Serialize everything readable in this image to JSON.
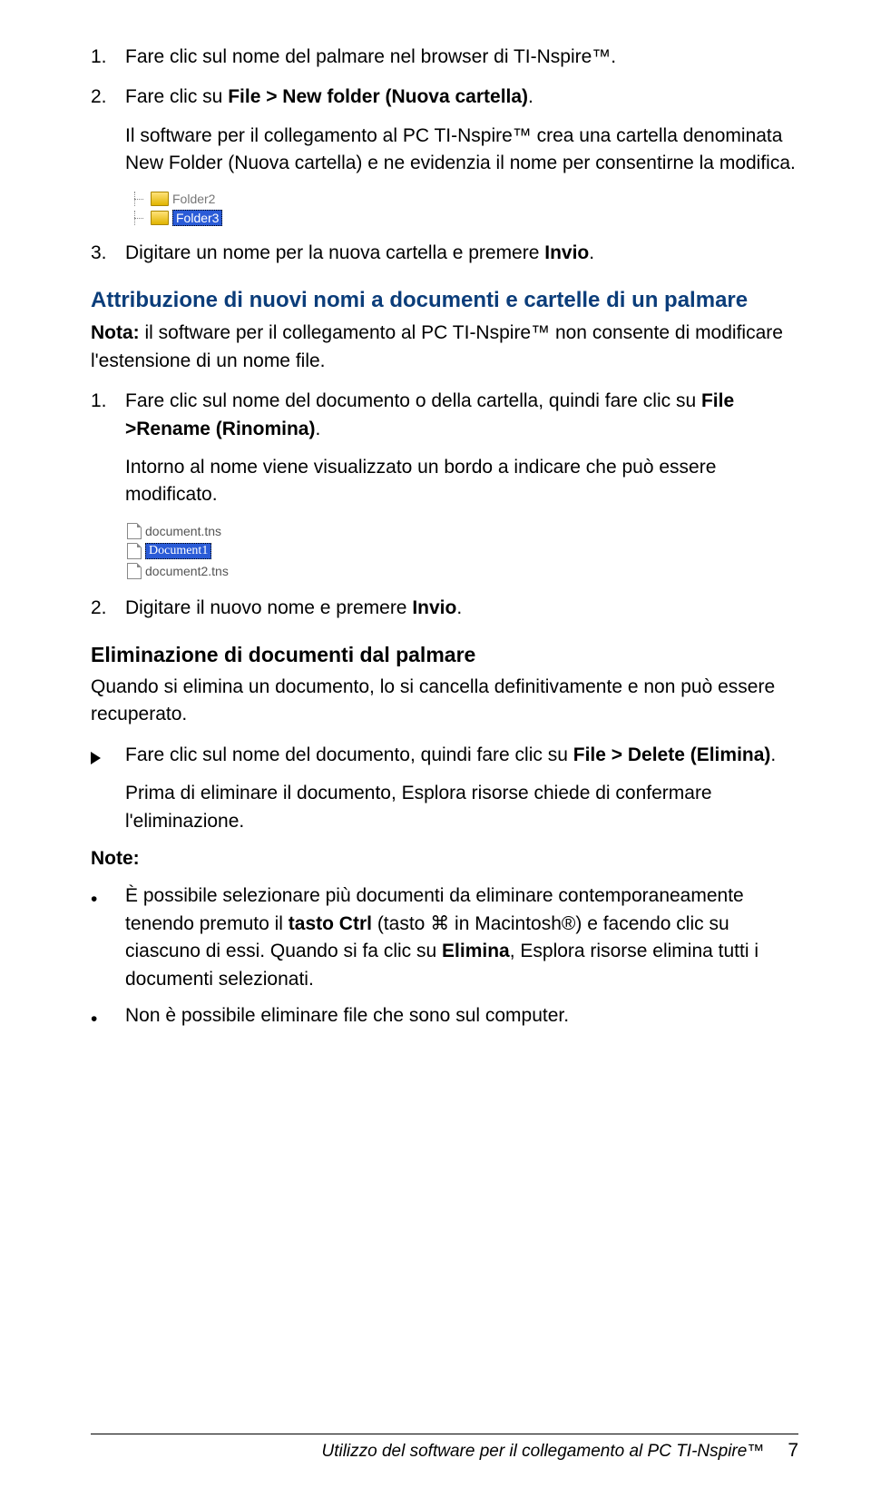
{
  "list1": {
    "items": [
      {
        "num": "1.",
        "p1_a": "Fare clic sul nome del palmare nel browser di TI-Nspire™."
      },
      {
        "num": "2.",
        "p1_a": "Fare clic su ",
        "p1_b": "File > New folder (Nuova cartella)",
        "p1_c": ".",
        "p2": "Il software per il collegamento al PC TI-Nspire™ crea una cartella denominata New Folder (Nuova cartella) e ne evidenzia il nome per consentirne la modifica."
      },
      {
        "num": "3.",
        "p1_a": "Digitare un nome per la nuova cartella e premere ",
        "p1_b": "Invio",
        "p1_c": "."
      }
    ]
  },
  "img1": {
    "row1": "Folder2",
    "row2": "Folder3"
  },
  "h2_rename": "Attribuzione di nuovi nomi a documenti e cartelle di un palmare",
  "note_rename_a": "Nota:",
  "note_rename_b": " il software per il collegamento al PC TI-Nspire™ non consente di modificare l'estensione di un nome file.",
  "list2": {
    "items": [
      {
        "num": "1.",
        "p1_a": "Fare clic sul nome del documento o della cartella, quindi fare clic su ",
        "p1_b": "File >Rename (Rinomina)",
        "p1_c": ".",
        "p2": "Intorno al nome viene visualizzato un bordo a indicare che può essere modificato."
      },
      {
        "num": "2.",
        "p1_a": "Digitare il nuovo nome e premere ",
        "p1_b": "Invio",
        "p1_c": "."
      }
    ]
  },
  "img2": {
    "row1": "document.tns",
    "row2": "Document1",
    "row3": "document2.tns"
  },
  "h2_delete": "Eliminazione di documenti dal palmare",
  "p_delete_intro": "Quando si elimina un documento, lo si cancella definitivamente e non può essere recuperato.",
  "bullet_delete": {
    "p1_a": "Fare clic sul nome del documento, quindi fare clic su ",
    "p1_b": "File > Delete (Elimina)",
    "p1_c": ".",
    "p2": "Prima di eliminare il documento, Esplora risorse chiede di confermare l'eliminazione."
  },
  "note_label": "Note:",
  "notes": {
    "n1_a": "È possibile selezionare più documenti da eliminare contemporaneamente tenendo premuto il ",
    "n1_b": "tasto Ctrl",
    "n1_c": "  (tasto ",
    "n1_d": "⌘",
    "n1_e": " in Macintosh®) e facendo clic su ciascuno di essi. Quando si fa clic su ",
    "n1_f": "Elimina",
    "n1_g": ", Esplora risorse  elimina tutti i documenti selezionati.",
    "n2": "Non è possibile eliminare file che sono sul computer."
  },
  "footer": {
    "title": "Utilizzo del software per il collegamento al PC TI-Nspire™",
    "page": "7"
  }
}
